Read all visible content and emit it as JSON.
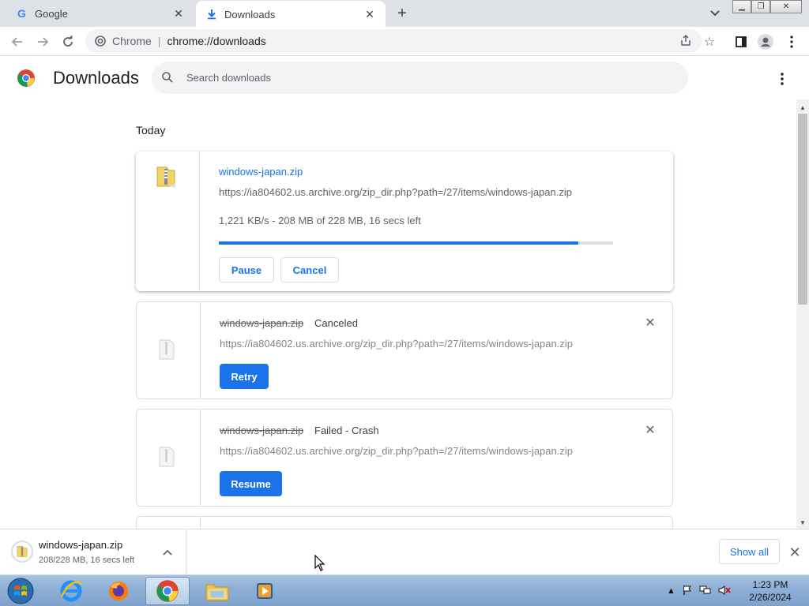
{
  "browser": {
    "tabs": [
      {
        "title": "Google",
        "active": false
      },
      {
        "title": "Downloads",
        "active": true
      }
    ],
    "omnibox": {
      "site_name": "Chrome",
      "separator": "|",
      "url": "chrome://downloads"
    }
  },
  "page": {
    "title": "Downloads",
    "search_placeholder": "Search downloads",
    "section_label": "Today"
  },
  "downloads": [
    {
      "filename": "windows-japan.zip",
      "state": "in_progress",
      "status_label": "",
      "url": "https://ia804602.us.archive.org/zip_dir.php?path=/27/items/windows-japan.zip",
      "progress_text": "1,221 KB/s - 208 MB of 228 MB, 16 secs left",
      "progress": 0.912,
      "buttons": {
        "pause": "Pause",
        "cancel": "Cancel"
      }
    },
    {
      "filename": "windows-japan.zip",
      "state": "canceled",
      "status_label": "Canceled",
      "url": "https://ia804602.us.archive.org/zip_dir.php?path=/27/items/windows-japan.zip",
      "action": "Retry"
    },
    {
      "filename": "windows-japan.zip",
      "state": "failed",
      "status_label": "Failed - Crash",
      "url": "https://ia804602.us.archive.org/zip_dir.php?path=/27/items/windows-japan.zip",
      "action": "Resume"
    }
  ],
  "shelf": {
    "filename": "windows-japan.zip",
    "status": "208/228 MB, 16 secs left",
    "show_all": "Show all"
  },
  "taskbar": {
    "time": "1:23 PM",
    "date": "2/26/2024",
    "apps": [
      "internet-explorer",
      "firefox",
      "chrome",
      "file-explorer",
      "media-player"
    ]
  },
  "colors": {
    "accent": "#1a73e8",
    "tabstrip": "#dee1e6",
    "omnibox": "#f1f3f4"
  }
}
